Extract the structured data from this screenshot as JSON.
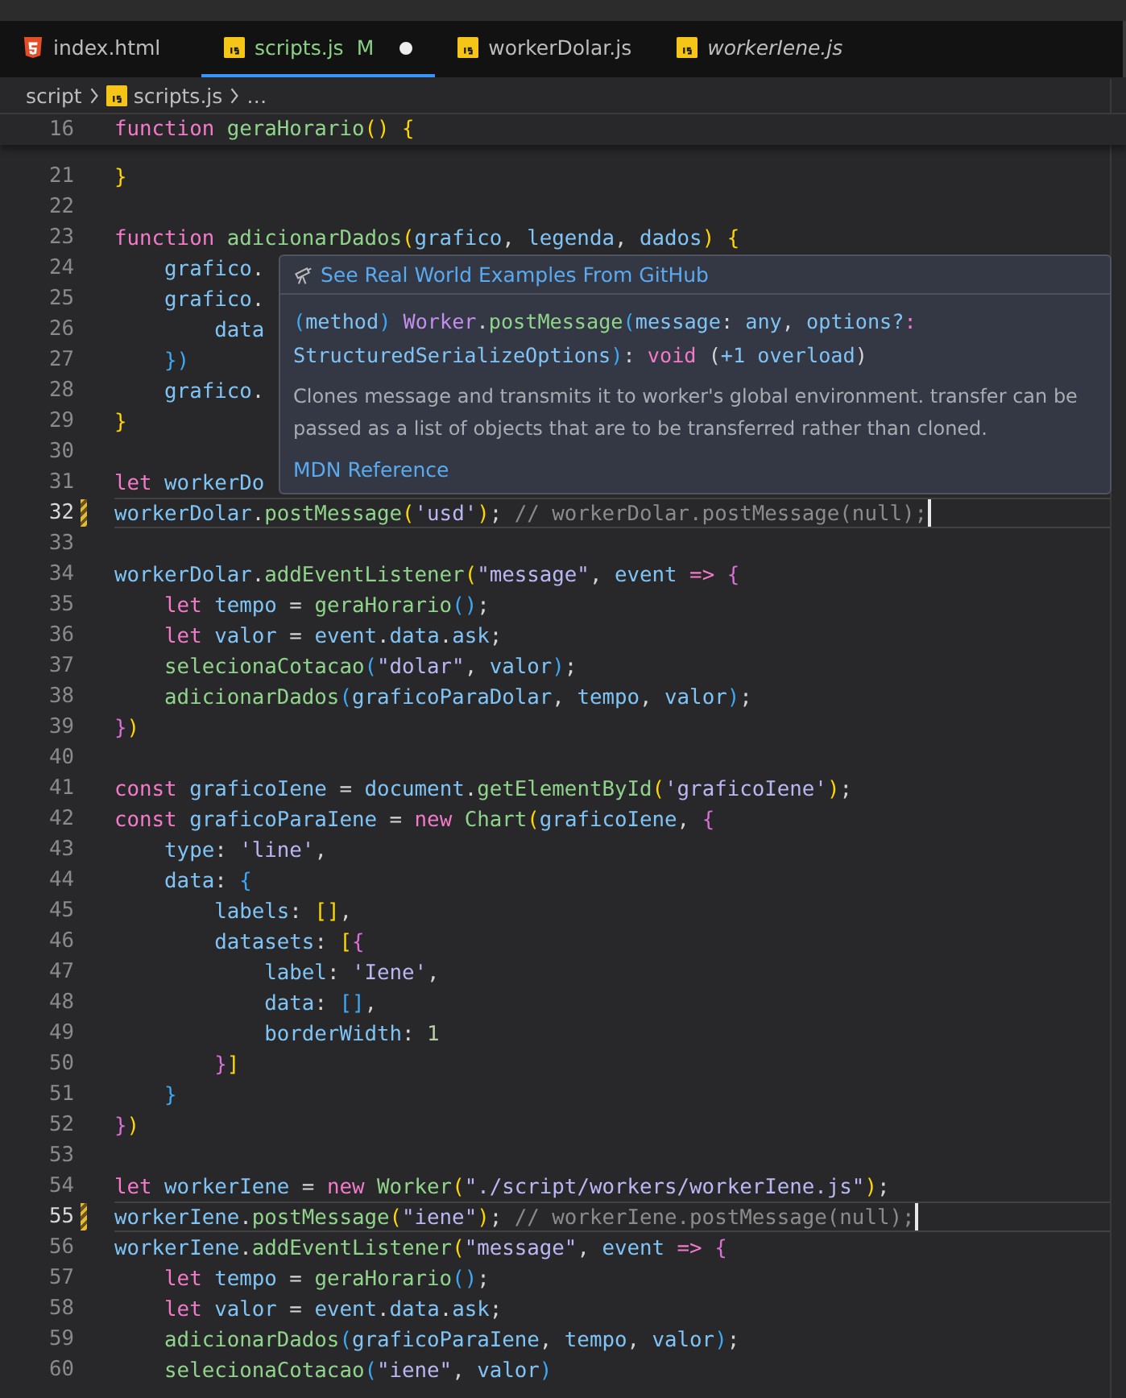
{
  "tabs": [
    {
      "label": "index.html",
      "kind": "html",
      "selected": false,
      "dirty": false,
      "preview": false
    },
    {
      "label": "scripts.js",
      "kind": "js",
      "badge": "M",
      "selected": true,
      "dirty": true,
      "preview": false
    },
    {
      "label": "workerDolar.js",
      "kind": "js",
      "selected": false,
      "dirty": false,
      "preview": false
    },
    {
      "label": "workerIene.js",
      "kind": "js",
      "selected": false,
      "dirty": false,
      "preview": true
    }
  ],
  "breadcrumb": [
    {
      "label": "script",
      "kind": "folder"
    },
    {
      "label": "scripts.js",
      "kind": "js"
    },
    {
      "label": "…",
      "kind": "more"
    }
  ],
  "sticky_line": {
    "n": "16",
    "tokens": [
      {
        "text": "function ",
        "kind": "kw"
      },
      {
        "text": "geraHorario",
        "kind": "fn"
      },
      {
        "text": "() {",
        "kind": "b1"
      }
    ]
  },
  "lines": [
    {
      "n": "21",
      "current": false,
      "modified": false,
      "tokens": [
        {
          "text": "}",
          "kind": "b1"
        }
      ]
    },
    {
      "n": "22",
      "current": false,
      "modified": false
    },
    {
      "n": "23",
      "current": false,
      "modified": false,
      "tokens": [
        {
          "text": "function ",
          "kind": "kw"
        },
        {
          "text": "adicionarDados",
          "kind": "fn"
        },
        {
          "text": "(",
          "kind": "b1"
        },
        {
          "text": "grafico",
          "kind": "v"
        },
        {
          "text": ", ",
          "kind": "p"
        },
        {
          "text": "legenda",
          "kind": "v"
        },
        {
          "text": ", ",
          "kind": "p"
        },
        {
          "text": "dados",
          "kind": "v"
        },
        {
          "text": ") {",
          "kind": "b1"
        }
      ]
    },
    {
      "n": "24",
      "current": false,
      "modified": false,
      "tokens": [
        {
          "text": "    grafico",
          "kind": "v"
        },
        {
          "text": ".",
          "kind": "p"
        }
      ]
    },
    {
      "n": "25",
      "current": false,
      "modified": false,
      "tokens": [
        {
          "text": "    grafico",
          "kind": "v"
        },
        {
          "text": ".",
          "kind": "p"
        }
      ]
    },
    {
      "n": "26",
      "current": false,
      "modified": false,
      "tokens": [
        {
          "text": "        data",
          "kind": "v"
        }
      ]
    },
    {
      "n": "27",
      "current": false,
      "modified": false,
      "tokens": [
        {
          "text": "    })",
          "kind": "b3"
        }
      ]
    },
    {
      "n": "28",
      "current": false,
      "modified": false,
      "tokens": [
        {
          "text": "    grafico",
          "kind": "v"
        },
        {
          "text": ".",
          "kind": "p"
        }
      ]
    },
    {
      "n": "29",
      "current": false,
      "modified": false,
      "tokens": [
        {
          "text": "}",
          "kind": "b1"
        }
      ]
    },
    {
      "n": "30",
      "current": false,
      "modified": false
    },
    {
      "n": "31",
      "current": false,
      "modified": false,
      "tokens": [
        {
          "text": "let ",
          "kind": "kw"
        },
        {
          "text": "workerDo",
          "kind": "v"
        }
      ]
    },
    {
      "n": "32",
      "current": true,
      "modified": true,
      "tokens": [
        {
          "text": "workerDolar",
          "kind": "v"
        },
        {
          "text": ".",
          "kind": "p"
        },
        {
          "text": "postMessage",
          "kind": "fn"
        },
        {
          "text": "(",
          "kind": "b1"
        },
        {
          "text": "'usd'",
          "kind": "s"
        },
        {
          "text": ")",
          "kind": "b1"
        },
        {
          "text": "; ",
          "kind": "p"
        },
        {
          "text": "// workerDolar.postMessage(null);",
          "kind": "c"
        }
      ]
    },
    {
      "n": "33",
      "current": false,
      "modified": false
    },
    {
      "n": "34",
      "current": false,
      "modified": false,
      "tokens": [
        {
          "text": "workerDolar",
          "kind": "v"
        },
        {
          "text": ".",
          "kind": "p"
        },
        {
          "text": "addEventListener",
          "kind": "fn"
        },
        {
          "text": "(",
          "kind": "b1"
        },
        {
          "text": "\"message\"",
          "kind": "s"
        },
        {
          "text": ", ",
          "kind": "p"
        },
        {
          "text": "event",
          "kind": "v"
        },
        {
          "text": " => ",
          "kind": "kw"
        },
        {
          "text": "{",
          "kind": "b2"
        }
      ]
    },
    {
      "n": "35",
      "current": false,
      "modified": false,
      "tokens": [
        {
          "text": "    let ",
          "kind": "kw"
        },
        {
          "text": "tempo",
          "kind": "v"
        },
        {
          "text": " = ",
          "kind": "p"
        },
        {
          "text": "geraHorario",
          "kind": "fn"
        },
        {
          "text": "()",
          "kind": "b3"
        },
        {
          "text": ";",
          "kind": "p"
        }
      ]
    },
    {
      "n": "36",
      "current": false,
      "modified": false,
      "tokens": [
        {
          "text": "    let ",
          "kind": "kw"
        },
        {
          "text": "valor",
          "kind": "v"
        },
        {
          "text": " = ",
          "kind": "p"
        },
        {
          "text": "event",
          "kind": "v"
        },
        {
          "text": ".",
          "kind": "p"
        },
        {
          "text": "data",
          "kind": "v"
        },
        {
          "text": ".",
          "kind": "p"
        },
        {
          "text": "ask",
          "kind": "v"
        },
        {
          "text": ";",
          "kind": "p"
        }
      ]
    },
    {
      "n": "37",
      "current": false,
      "modified": false,
      "tokens": [
        {
          "text": "    selecionaCotacao",
          "kind": "fn"
        },
        {
          "text": "(",
          "kind": "b3"
        },
        {
          "text": "\"dolar\"",
          "kind": "s"
        },
        {
          "text": ", ",
          "kind": "p"
        },
        {
          "text": "valor",
          "kind": "v"
        },
        {
          "text": ")",
          "kind": "b3"
        },
        {
          "text": ";",
          "kind": "p"
        }
      ]
    },
    {
      "n": "38",
      "current": false,
      "modified": false,
      "tokens": [
        {
          "text": "    adicionarDados",
          "kind": "fn"
        },
        {
          "text": "(",
          "kind": "b3"
        },
        {
          "text": "graficoParaDolar",
          "kind": "v"
        },
        {
          "text": ", ",
          "kind": "p"
        },
        {
          "text": "tempo",
          "kind": "v"
        },
        {
          "text": ", ",
          "kind": "p"
        },
        {
          "text": "valor",
          "kind": "v"
        },
        {
          "text": ")",
          "kind": "b3"
        },
        {
          "text": ";",
          "kind": "p"
        }
      ]
    },
    {
      "n": "39",
      "current": false,
      "modified": false,
      "tokens": [
        {
          "text": "}",
          "kind": "b2"
        },
        {
          "text": ")",
          "kind": "b1"
        }
      ]
    },
    {
      "n": "40",
      "current": false,
      "modified": false
    },
    {
      "n": "41",
      "current": false,
      "modified": false,
      "tokens": [
        {
          "text": "const ",
          "kind": "kw"
        },
        {
          "text": "graficoIene",
          "kind": "v"
        },
        {
          "text": " = ",
          "kind": "p"
        },
        {
          "text": "document",
          "kind": "v"
        },
        {
          "text": ".",
          "kind": "p"
        },
        {
          "text": "getElementById",
          "kind": "fn"
        },
        {
          "text": "(",
          "kind": "b1"
        },
        {
          "text": "'graficoIene'",
          "kind": "s"
        },
        {
          "text": ")",
          "kind": "b1"
        },
        {
          "text": ";",
          "kind": "p"
        }
      ]
    },
    {
      "n": "42",
      "current": false,
      "modified": false,
      "tokens": [
        {
          "text": "const ",
          "kind": "kw"
        },
        {
          "text": "graficoParaIene",
          "kind": "v"
        },
        {
          "text": " = ",
          "kind": "p"
        },
        {
          "text": "new ",
          "kind": "kw"
        },
        {
          "text": "Chart",
          "kind": "fn"
        },
        {
          "text": "(",
          "kind": "b1"
        },
        {
          "text": "graficoIene",
          "kind": "v"
        },
        {
          "text": ", ",
          "kind": "p"
        },
        {
          "text": "{",
          "kind": "b2"
        }
      ]
    },
    {
      "n": "43",
      "current": false,
      "modified": false,
      "tokens": [
        {
          "text": "    type",
          "kind": "v"
        },
        {
          "text": ": ",
          "kind": "p"
        },
        {
          "text": "'line'",
          "kind": "s"
        },
        {
          "text": ",",
          "kind": "p"
        }
      ]
    },
    {
      "n": "44",
      "current": false,
      "modified": false,
      "tokens": [
        {
          "text": "    data",
          "kind": "v"
        },
        {
          "text": ": ",
          "kind": "p"
        },
        {
          "text": "{",
          "kind": "b3"
        }
      ]
    },
    {
      "n": "45",
      "current": false,
      "modified": false,
      "tokens": [
        {
          "text": "        labels",
          "kind": "v"
        },
        {
          "text": ": ",
          "kind": "p"
        },
        {
          "text": "[]",
          "kind": "b1"
        },
        {
          "text": ",",
          "kind": "p"
        }
      ]
    },
    {
      "n": "46",
      "current": false,
      "modified": false,
      "tokens": [
        {
          "text": "        datasets",
          "kind": "v"
        },
        {
          "text": ": ",
          "kind": "p"
        },
        {
          "text": "[",
          "kind": "b1"
        },
        {
          "text": "{",
          "kind": "b2"
        }
      ]
    },
    {
      "n": "47",
      "current": false,
      "modified": false,
      "tokens": [
        {
          "text": "            label",
          "kind": "v"
        },
        {
          "text": ": ",
          "kind": "p"
        },
        {
          "text": "'Iene'",
          "kind": "s"
        },
        {
          "text": ",",
          "kind": "p"
        }
      ]
    },
    {
      "n": "48",
      "current": false,
      "modified": false,
      "tokens": [
        {
          "text": "            data",
          "kind": "v"
        },
        {
          "text": ": ",
          "kind": "p"
        },
        {
          "text": "[]",
          "kind": "b3"
        },
        {
          "text": ",",
          "kind": "p"
        }
      ]
    },
    {
      "n": "49",
      "current": false,
      "modified": false,
      "tokens": [
        {
          "text": "            borderWidth",
          "kind": "v"
        },
        {
          "text": ": ",
          "kind": "p"
        },
        {
          "text": "1",
          "kind": "n"
        }
      ]
    },
    {
      "n": "50",
      "current": false,
      "modified": false,
      "tokens": [
        {
          "text": "        }",
          "kind": "b2"
        },
        {
          "text": "]",
          "kind": "b1"
        }
      ]
    },
    {
      "n": "51",
      "current": false,
      "modified": false,
      "tokens": [
        {
          "text": "    }",
          "kind": "b3"
        }
      ]
    },
    {
      "n": "52",
      "current": false,
      "modified": false,
      "tokens": [
        {
          "text": "}",
          "kind": "b2"
        },
        {
          "text": ")",
          "kind": "b1"
        }
      ]
    },
    {
      "n": "53",
      "current": false,
      "modified": false
    },
    {
      "n": "54",
      "current": false,
      "modified": false,
      "tokens": [
        {
          "text": "let ",
          "kind": "kw"
        },
        {
          "text": "workerIene",
          "kind": "v"
        },
        {
          "text": " = ",
          "kind": "p"
        },
        {
          "text": "new ",
          "kind": "kw"
        },
        {
          "text": "Worker",
          "kind": "fn"
        },
        {
          "text": "(",
          "kind": "b1"
        },
        {
          "text": "\"./script/workers/workerIene.js\"",
          "kind": "s"
        },
        {
          "text": ")",
          "kind": "b1"
        },
        {
          "text": ";",
          "kind": "p"
        }
      ]
    },
    {
      "n": "55",
      "current": true,
      "modified": true,
      "tokens": [
        {
          "text": "workerIene",
          "kind": "v"
        },
        {
          "text": ".",
          "kind": "p"
        },
        {
          "text": "postMessage",
          "kind": "fn"
        },
        {
          "text": "(",
          "kind": "b1"
        },
        {
          "text": "\"iene\"",
          "kind": "s"
        },
        {
          "text": ")",
          "kind": "b1"
        },
        {
          "text": "; ",
          "kind": "p"
        },
        {
          "text": "// workerIene.postMessage(null);",
          "kind": "c"
        }
      ]
    },
    {
      "n": "56",
      "current": false,
      "modified": false,
      "tokens": [
        {
          "text": "workerIene",
          "kind": "v"
        },
        {
          "text": ".",
          "kind": "p"
        },
        {
          "text": "addEventListener",
          "kind": "fn"
        },
        {
          "text": "(",
          "kind": "b1"
        },
        {
          "text": "\"message\"",
          "kind": "s"
        },
        {
          "text": ", ",
          "kind": "p"
        },
        {
          "text": "event",
          "kind": "v"
        },
        {
          "text": " => ",
          "kind": "kw"
        },
        {
          "text": "{",
          "kind": "b2"
        }
      ]
    },
    {
      "n": "57",
      "current": false,
      "modified": false,
      "tokens": [
        {
          "text": "    let ",
          "kind": "kw"
        },
        {
          "text": "tempo",
          "kind": "v"
        },
        {
          "text": " = ",
          "kind": "p"
        },
        {
          "text": "geraHorario",
          "kind": "fn"
        },
        {
          "text": "()",
          "kind": "b3"
        },
        {
          "text": ";",
          "kind": "p"
        }
      ]
    },
    {
      "n": "58",
      "current": false,
      "modified": false,
      "tokens": [
        {
          "text": "    let ",
          "kind": "kw"
        },
        {
          "text": "valor",
          "kind": "v"
        },
        {
          "text": " = ",
          "kind": "p"
        },
        {
          "text": "event",
          "kind": "v"
        },
        {
          "text": ".",
          "kind": "p"
        },
        {
          "text": "data",
          "kind": "v"
        },
        {
          "text": ".",
          "kind": "p"
        },
        {
          "text": "ask",
          "kind": "v"
        },
        {
          "text": ";",
          "kind": "p"
        }
      ]
    },
    {
      "n": "59",
      "current": false,
      "modified": false,
      "tokens": [
        {
          "text": "    adicionarDados",
          "kind": "fn"
        },
        {
          "text": "(",
          "kind": "b3"
        },
        {
          "text": "graficoParaIene",
          "kind": "v"
        },
        {
          "text": ", ",
          "kind": "p"
        },
        {
          "text": "tempo",
          "kind": "v"
        },
        {
          "text": ", ",
          "kind": "p"
        },
        {
          "text": "valor",
          "kind": "v"
        },
        {
          "text": ")",
          "kind": "b3"
        },
        {
          "text": ";",
          "kind": "p"
        }
      ]
    },
    {
      "n": "60",
      "current": false,
      "modified": false,
      "tokens": [
        {
          "text": "    selecionaCotacao",
          "kind": "fn"
        },
        {
          "text": "(",
          "kind": "b3"
        },
        {
          "text": "\"iene\"",
          "kind": "s"
        },
        {
          "text": ", ",
          "kind": "p"
        },
        {
          "text": "valor",
          "kind": "v"
        },
        {
          "text": ")",
          "kind": "b3"
        }
      ]
    }
  ],
  "hover": {
    "link": "See Real World Examples From GitHub",
    "signature": [
      {
        "tokens": [
          {
            "text": "(",
            "kind": "b3"
          },
          {
            "text": "method",
            "kind": "v"
          },
          {
            "text": ") ",
            "kind": "b3"
          },
          {
            "text": "Worker",
            "kind": "cls"
          },
          {
            "text": ".",
            "kind": "p"
          },
          {
            "text": "postMessage",
            "kind": "fn"
          },
          {
            "text": "(",
            "kind": "b3"
          },
          {
            "text": "message",
            "kind": "v"
          },
          {
            "text": ": ",
            "kind": "p"
          },
          {
            "text": "any",
            "kind": "v"
          },
          {
            "text": ", ",
            "kind": "p"
          },
          {
            "text": "options?",
            "kind": "v"
          },
          {
            "text": ":",
            "kind": "kw"
          }
        ]
      },
      {
        "tokens": [
          {
            "text": "StructuredSerializeOptions",
            "kind": "v"
          },
          {
            "text": ")",
            "kind": "b3"
          },
          {
            "text": ": ",
            "kind": "p"
          },
          {
            "text": "void",
            "kind": "kw"
          },
          {
            "text": " (",
            "kind": "p"
          },
          {
            "text": "+1 overload",
            "kind": "v"
          },
          {
            "text": ")",
            "kind": "p"
          }
        ]
      }
    ],
    "description": "Clones message and transmits it to worker's global environment. transfer can be passed as a list of objects that are to be transferred rather than cloned.",
    "reference": "MDN Reference"
  }
}
